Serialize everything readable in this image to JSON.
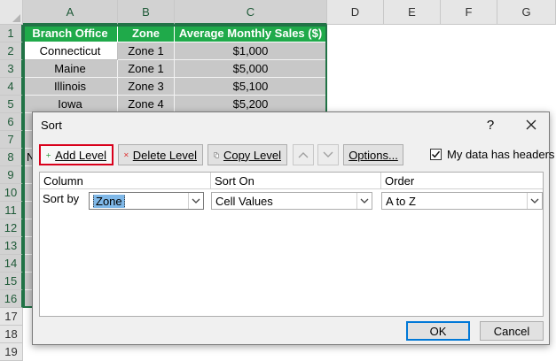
{
  "sheet": {
    "columns": [
      "A",
      "B",
      "C",
      "D",
      "E",
      "F",
      "G"
    ],
    "rows": [
      "1",
      "2",
      "3",
      "4",
      "5",
      "6",
      "7",
      "8",
      "9",
      "10",
      "11",
      "12",
      "13",
      "14",
      "15",
      "16",
      "17",
      "18",
      "19"
    ],
    "headers": [
      "Branch Office",
      "Zone",
      "Average Monthly Sales ($)"
    ],
    "data": [
      [
        "Connecticut",
        "Zone 1",
        "$1,000"
      ],
      [
        "Maine",
        "Zone 1",
        "$5,000"
      ],
      [
        "Illinois",
        "Zone 3",
        "$5,100"
      ],
      [
        "Iowa",
        "Zone 4",
        "$5,200"
      ]
    ],
    "partial_text": "N",
    "colors": {
      "header_fill": "#1faa4a",
      "selection": "#217346",
      "data_fill": "#c8c8c8"
    }
  },
  "dialog": {
    "title": "Sort",
    "help": "?",
    "toolbar": {
      "add_level": "Add Level",
      "delete_level": "Delete Level",
      "copy_level": "Copy Level",
      "options": "Options...",
      "my_data_has_headers": "My data has headers",
      "my_data_has_headers_checked": true
    },
    "grid": {
      "col_column": "Column",
      "col_sort_on": "Sort On",
      "col_order": "Order",
      "row_label": "Sort by",
      "column_value": "Zone",
      "sort_on_value": "Cell Values",
      "order_value": "A to Z"
    },
    "ok": "OK",
    "cancel": "Cancel",
    "icons": {
      "add": "plus-icon",
      "delete": "x-icon",
      "copy": "copy-icon",
      "up": "chevron-up-icon",
      "down": "chevron-down-icon",
      "close": "close-icon"
    }
  }
}
